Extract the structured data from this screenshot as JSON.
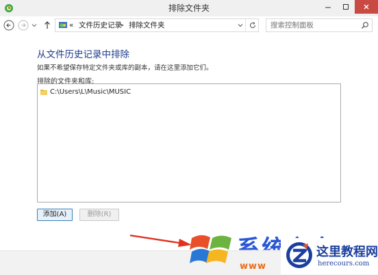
{
  "window": {
    "title": "排除文件夹"
  },
  "nav": {
    "breadcrumbs": [
      "«",
      "文件历史记录",
      "▸",
      "排除文件夹"
    ],
    "search_placeholder": "搜索控制面板"
  },
  "main": {
    "heading": "从文件历史记录中排除",
    "description": "如果不希望保存特定文件夹或库的副本，请在这里添加它们。",
    "list_label": "排除的文件夹和库:",
    "items": [
      {
        "path": "C:\\Users\\L\\Music\\MUSIC",
        "icon": "folder-icon"
      }
    ],
    "buttons": {
      "add": "添加(A)",
      "delete": "删除(R)"
    }
  },
  "watermark": {
    "brand1": "系统之家",
    "brand1_url": "www",
    "brand2": "这里教程网",
    "brand2_url": "herecours.com"
  },
  "colors": {
    "heading": "#1e3a8a",
    "close": "#c94a42",
    "button_border": "#3c7fb1"
  }
}
